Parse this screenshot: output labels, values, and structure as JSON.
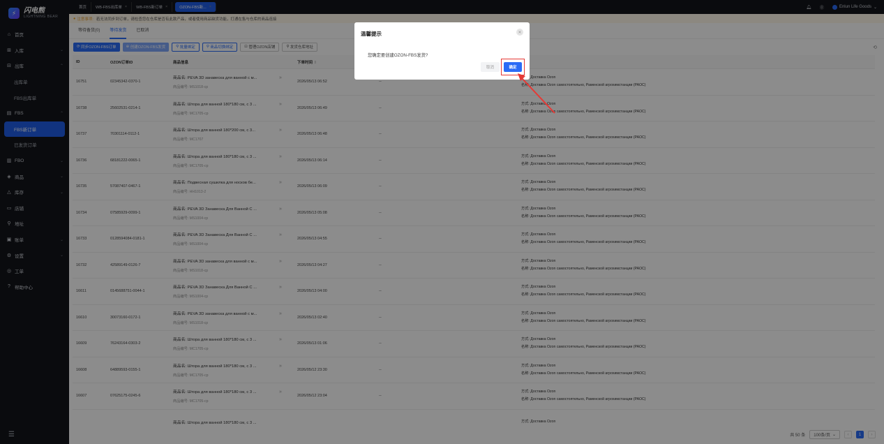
{
  "sidebar": {
    "logo_zh": "闪电熊",
    "logo_en": "LIGHTNING BEAR",
    "items": [
      {
        "label": "首页",
        "icon": "home-icon",
        "chev": ""
      },
      {
        "label": "入库",
        "icon": "inbound-icon",
        "chev": "⌄"
      },
      {
        "label": "出库",
        "icon": "outbound-icon",
        "chev": "⌃"
      },
      {
        "label": "出库单",
        "sub": true
      },
      {
        "label": "FBS出库单",
        "sub": true
      },
      {
        "label": "FBS",
        "icon": "fbs-icon",
        "chev": "⌃"
      },
      {
        "label": "FBS新订单",
        "sub": true,
        "active": true
      },
      {
        "label": "已发货订单",
        "sub": true
      },
      {
        "label": "FBO",
        "icon": "fbo-icon",
        "chev": "⌄"
      },
      {
        "label": "商品",
        "icon": "goods-icon",
        "chev": "⌄"
      },
      {
        "label": "库存",
        "icon": "stock-icon",
        "chev": "⌄"
      },
      {
        "label": "店铺",
        "icon": "shop-icon",
        "chev": ""
      },
      {
        "label": "地址",
        "icon": "location-icon",
        "chev": ""
      },
      {
        "label": "账单",
        "icon": "bill-icon",
        "chev": "⌄"
      },
      {
        "label": "设置",
        "icon": "settings-icon",
        "chev": "⌄"
      },
      {
        "label": "工单",
        "icon": "ticket-icon",
        "chev": ""
      },
      {
        "label": "帮助中心",
        "icon": "help-icon",
        "chev": ""
      }
    ]
  },
  "tabs": [
    {
      "label": "首页",
      "closable": false
    },
    {
      "label": "WB-FBS出库单",
      "closable": true
    },
    {
      "label": "WB-FBS新订单",
      "closable": true
    },
    {
      "label": "OZON-FBS新...",
      "closable": true,
      "active": true
    }
  ],
  "topbar": {
    "shop": "Enlun Life Goods"
  },
  "notice": {
    "label": "注意事项:",
    "text": "若无法同步到订单，请检查您在仓库是否有此款产品，或者使用商品缺货功能，打通在售与仓库的商品连接"
  },
  "subtabs": [
    "等待备货(0)",
    "等待发货",
    "已取消"
  ],
  "toolbar": {
    "sync": "同步OZON-FBS订单",
    "create": "创建OZON-FBS发货",
    "bind": "批量绑定",
    "unbind": "商品切换绑定",
    "manage": "管理OZON店铺",
    "address": "发货仓库地址"
  },
  "table": {
    "headers": [
      "ID",
      "OZON订单ID",
      "商品信息",
      "下单时间",
      "",
      ""
    ],
    "rows": [
      {
        "id": "16751",
        "order": "02345342-0370-1",
        "name": "PEVA 3D занавеска для ванной с м...",
        "code": "MS1018-cp",
        "time": "2026/05/13 06:52"
      },
      {
        "id": "16738",
        "order": "25602531-0214-1",
        "name": "Штора для ванной 180*180 см, с 3 ...",
        "code": "MC1705-cp",
        "time": "2026/05/13 06:49"
      },
      {
        "id": "16737",
        "order": "70301114-0112-1",
        "name": "Штора для ванной 180*200 см, с 3...",
        "code": "MC1707",
        "time": "2026/05/13 06:48"
      },
      {
        "id": "16736",
        "order": "68181222-0065-1",
        "name": "Штора для ванной 180*180 см, с 3 ...",
        "code": "MC1705-cp",
        "time": "2026/05/13 06:14"
      },
      {
        "id": "16735",
        "order": "57087407-0467-1",
        "name": "Подвесная сушилка для носков бе...",
        "code": "HH1013-2",
        "time": "2026/05/13 06:09"
      },
      {
        "id": "16734",
        "order": "07585929-0099-1",
        "name": "PEVA 3D Занавеска Для Ванной С ...",
        "code": "MS1004-cp",
        "time": "2026/05/13 05:08"
      },
      {
        "id": "16733",
        "order": "0128594084-0181-1",
        "name": "PEVA 3D Занавеска Для Ванной С ...",
        "code": "MS1004-cp",
        "time": "2026/05/13 04:55"
      },
      {
        "id": "16732",
        "order": "42589149-0126-7",
        "name": "PEVA 3D занавеска для ванной с м...",
        "code": "MS1018-cp",
        "time": "2026/05/13 04:27"
      },
      {
        "id": "16611",
        "order": "0145688751-0044-1",
        "name": "PEVA 3D Занавеска Для Ванной С ...",
        "code": "MS1004-cp",
        "time": "2026/05/13 04:00"
      },
      {
        "id": "16610",
        "order": "30073160-0172-1",
        "name": "PEVA 3D занавеска для ванной с м...",
        "code": "MS1018-cp",
        "time": "2026/05/13 02:40"
      },
      {
        "id": "16609",
        "order": "76243164-0303-2",
        "name": "Штора для ванной 180*180 см, с 3 ...",
        "code": "MC1705-cp",
        "time": "2026/05/13 01:06"
      },
      {
        "id": "16608",
        "order": "64889593-0155-1",
        "name": "Штора для ванной 180*180 см, с 3 ...",
        "code": "MC1705-cp",
        "time": "2026/05/12 23:30"
      },
      {
        "id": "16607",
        "order": "07625175-0245-6",
        "name": "Штора для ванной 180*180 см, с 3 ...",
        "code": "MC1705-cp",
        "time": "2026/05/12 23:04"
      },
      {
        "id": "",
        "order": "",
        "name": "Штора для ванной 180*180 см, с 3 ...",
        "code": "",
        "time": ""
      }
    ],
    "code_prefix": "商品编号:",
    "name_prefix": "商品名:",
    "status": "--",
    "method_label": "方式:",
    "method": "Доставка Ozon",
    "dest_label": "名称:",
    "dest": "Доставка Ozon самостоятельно, Раменской агрохимстанции (РАОС)"
  },
  "footer": {
    "total": "共 50 条",
    "page_size": "100条/页",
    "page": "1"
  },
  "dialog": {
    "title": "温馨提示",
    "message": "您确定要创建OZON-FBS发货?",
    "cancel": "取消",
    "ok": "确定"
  }
}
